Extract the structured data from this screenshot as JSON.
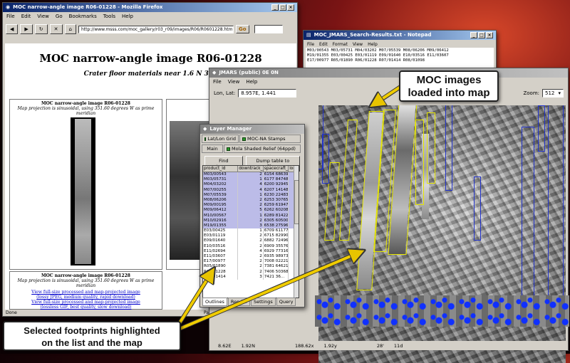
{
  "firefox": {
    "title": "MOC narrow-angle image R06-01228 - Mozilla Firefox",
    "menu": [
      "File",
      "Edit",
      "View",
      "Go",
      "Bookmarks",
      "Tools",
      "Help"
    ],
    "url": "http://www.msss.com/moc_gallery/r03_r09/images/R06/R0601228.html",
    "go_label": "Go",
    "heading": "MOC narrow-angle image R06-01228",
    "subheading": "Crater floor materials near 1.6 N 351",
    "left_cell_title": "MOC narrow-angle image R06-01228",
    "left_cell_sub": "Map projection is sinusoidal, using 351.60 degrees W as prime meridian",
    "right_cell_title": "MOC red-",
    "bottom_cell_title": "MOC narrow-angle image R06-01228",
    "bottom_cell_sub": "Map projection is sinusoidal, using 351.60 degrees W as prime meridian",
    "link1": "View full-size processed and map-projected image",
    "link1b": "(lossy JPEG, medium quality, rapid download)",
    "link2": "View full-size processed and map-projected image",
    "link2b": "(lossless GIF, best quality, slow download)",
    "status_done": "Done",
    "status_right": "Partly"
  },
  "notepad": {
    "title": "MOC_JMARS_Search-Results.txt - Notepad",
    "menu": [
      "File",
      "Edit",
      "Format",
      "View",
      "Help"
    ],
    "lines": [
      "M03/00543 M03/05731 M04/03202 M07/05539 M08/06206 M09/06412",
      "M19/01355 E03/00425 E03/01119 E09/01640 E10/03516 E11/03607",
      "E17/00977 R05/01890 R06/01228 R07/01414 R08/01098"
    ]
  },
  "jmars": {
    "title": "JMARS (public) 0E 0N",
    "menu": [
      "File",
      "View",
      "Help"
    ],
    "lonlat_label": "Lon, Lat:",
    "lonlat_value": "8.957E, 1.441",
    "zoom_label": "Zoom:",
    "zoom_value": "512",
    "status": [
      "8.62E",
      "1.92N",
      "188.62x",
      "1.92y",
      "28'",
      "11d"
    ]
  },
  "layer_manager": {
    "title": "Layer Manager",
    "tabs_row1": [
      "Lat/Lon Grid",
      "MOC-NA Stamps"
    ],
    "tabs_row2": [
      "Main",
      "Mola Shaded Relief (64ppd)"
    ],
    "find_label": "Find stamp...",
    "dump_label": "Dump table to file...",
    "columns": [
      "product_id",
      "downtrack_...",
      "spacecraft_...",
      "loca"
    ],
    "rows": [
      {
        "id": "M03/00543",
        "a": "2",
        "b": "6154 68639...",
        "sel": true
      },
      {
        "id": "M03/05731",
        "a": "1",
        "b": "6177 84748...",
        "sel": true
      },
      {
        "id": "M04/03202",
        "a": "4",
        "b": "6200 92945...",
        "sel": true
      },
      {
        "id": "M07/00255",
        "a": "4",
        "b": "6207 14148...",
        "sel": true
      },
      {
        "id": "M07/05539",
        "a": "1",
        "b": "6230 22483...",
        "sel": true
      },
      {
        "id": "M08/06206",
        "a": "2",
        "b": "6253 30765...",
        "sel": true
      },
      {
        "id": "M09/00195",
        "a": "2",
        "b": "6259 61947...",
        "sel": true
      },
      {
        "id": "M09/06412",
        "a": "5",
        "b": "6262 60208...",
        "sel": true
      },
      {
        "id": "M10/00567",
        "a": "1",
        "b": "6289 81422...",
        "sel": true
      },
      {
        "id": "M10/02916",
        "a": "2",
        "b": "6305 60500...",
        "sel": true
      },
      {
        "id": "M19/01355",
        "a": "3",
        "b": "6538 27596...",
        "sel": true
      },
      {
        "id": "E03/00425",
        "a": "1",
        "b": "6709 61177...",
        "sel": false
      },
      {
        "id": "E03/01119",
        "a": "2",
        "b": "6715 82990...",
        "sel": false
      },
      {
        "id": "E09/01640",
        "a": "2",
        "b": "6882 72496...",
        "sel": false
      },
      {
        "id": "E10/03516",
        "a": "2",
        "b": "6909 35576...",
        "sel": false
      },
      {
        "id": "E11/02694",
        "a": "4",
        "b": "6929 77316...",
        "sel": false
      },
      {
        "id": "E11/03607",
        "a": "2",
        "b": "6935 98973...",
        "sel": false
      },
      {
        "id": "E17/00977",
        "a": "2",
        "b": "7008 02221...",
        "sel": false
      },
      {
        "id": "R05/01890",
        "a": "2",
        "b": "7381 64621...",
        "sel": false
      },
      {
        "id": "R06/01228",
        "a": "2",
        "b": "7406 50368...",
        "sel": false
      },
      {
        "id": "R07/01414",
        "a": "3",
        "b": "7421 36...",
        "sel": false
      }
    ],
    "bottom_tabs": [
      "Outlines",
      "Render",
      "Settings",
      "Query"
    ]
  },
  "callouts": {
    "moc": "MOC images\nloaded into map",
    "selected": "Selected footprints highlighted\non the list and the map"
  }
}
